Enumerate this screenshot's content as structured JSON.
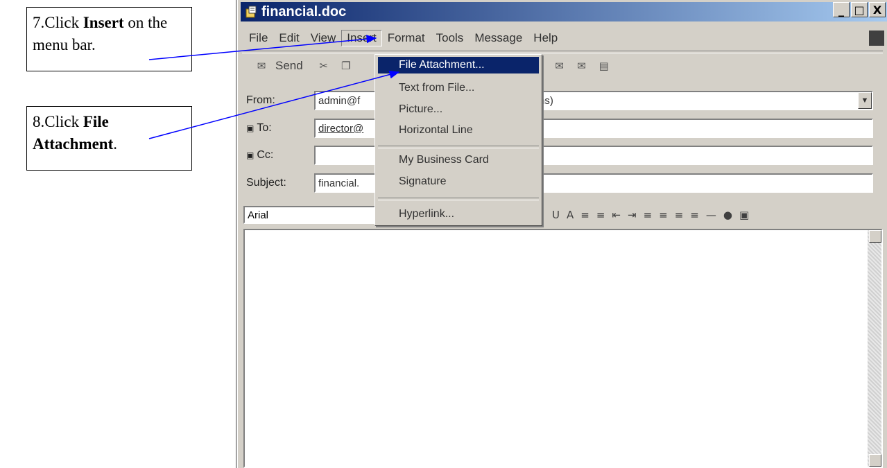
{
  "callouts": {
    "step7": {
      "prefix": "7.Click ",
      "bold": "Insert",
      "suffix": " on the menu bar."
    },
    "step8": {
      "prefix": "8.Click ",
      "bold": "File Attachment",
      "suffix": "."
    }
  },
  "window": {
    "title": "financial.doc",
    "buttons": [
      "_",
      "□",
      "X"
    ]
  },
  "menubar": {
    "items": [
      "File",
      "Edit",
      "View",
      "Insert",
      "Format",
      "Tools",
      "Message",
      "Help"
    ],
    "active": "Insert"
  },
  "toolbar": {
    "send_label": "Send"
  },
  "fields": {
    "from_label": "From:",
    "from_value": "admin@f",
    "from_value_tail": "ns)",
    "to_label": "To:",
    "to_value": "director@",
    "cc_label": "Cc:",
    "cc_value": "",
    "subject_label": "Subject:",
    "subject_value": "financial."
  },
  "format_bar": {
    "font": "Arial"
  },
  "insert_menu": {
    "items": [
      "File Attachment...",
      "Text from File...",
      "Picture...",
      "Horizontal Line",
      "My Business Card",
      "Signature",
      "Hyperlink..."
    ],
    "highlighted": "File Attachment..."
  },
  "colors": {
    "title_bar": "#0a246a",
    "highlight": "#0a246a",
    "arrow": "#0000ff"
  }
}
